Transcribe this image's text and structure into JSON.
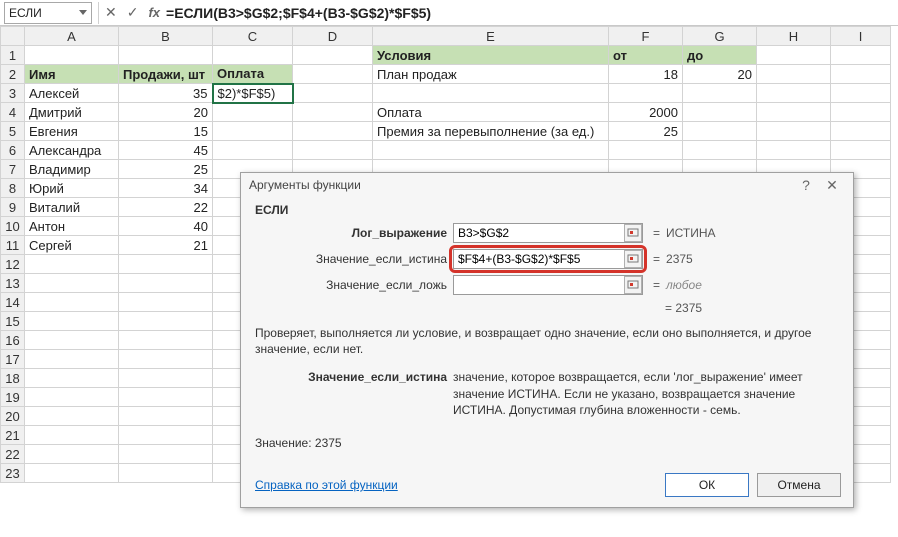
{
  "namebox": "ЕСЛИ",
  "formula": "=ЕСЛИ(B3>$G$2;$F$4+(B3-$G$2)*$F$5)",
  "columns": [
    "A",
    "B",
    "C",
    "D",
    "E",
    "F",
    "G",
    "H",
    "I"
  ],
  "rows_shown": 23,
  "data": {
    "A2": "Имя",
    "B2": "Продажи, шт",
    "C2": "Оплата",
    "A3": "Алексей",
    "B3": "35",
    "C3": "$2)*$F$5)",
    "A4": "Дмитрий",
    "B4": "20",
    "A5": "Евгения",
    "B5": "15",
    "A6": "Александра",
    "B6": "45",
    "A7": "Владимир",
    "B7": "25",
    "A8": "Юрий",
    "B8": "34",
    "A9": "Виталий",
    "B9": "22",
    "A10": "Антон",
    "B10": "40",
    "A11": "Сергей",
    "B11": "21",
    "E1": "Условия",
    "F1": "от",
    "G1": "до",
    "E2": "План продаж",
    "F2": "18",
    "G2": "20",
    "E4": "Оплата",
    "F4": "2000",
    "E5": "Премия за перевыполнение (за ед.)",
    "F5": "25"
  },
  "dialog": {
    "title": "Аргументы функции",
    "func": "ЕСЛИ",
    "args": {
      "label1": "Лог_выражение",
      "val1": "B3>$G$2",
      "res1": "ИСТИНА",
      "label2": "Значение_если_истина",
      "val2": "$F$4+(B3-$G$2)*$F$5",
      "res2": "2375",
      "label3": "Значение_если_ложь",
      "val3": "",
      "res3": "любое"
    },
    "overall_result": "2375",
    "desc": "Проверяет, выполняется ли условие, и возвращает одно значение, если оно выполняется, и другое значение, если нет.",
    "arg_desc_label": "Значение_если_истина",
    "arg_desc_text": "значение, которое возвращается, если 'лог_выражение' имеет значение ИСТИНА. Если не указано, возвращается значение ИСТИНА. Допустимая глубина вложенности - семь.",
    "value_label": "Значение:",
    "value": "2375",
    "help": "Справка по этой функции",
    "ok": "ОК",
    "cancel": "Отмена"
  }
}
